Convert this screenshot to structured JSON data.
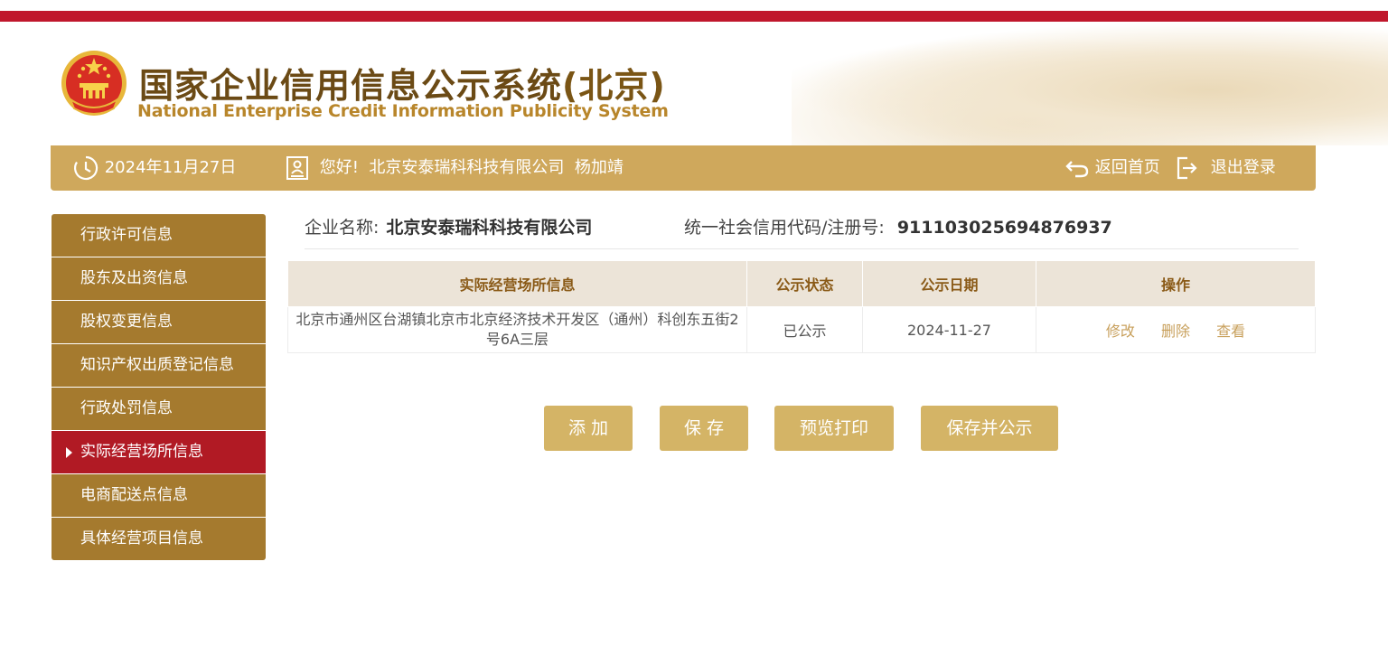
{
  "header": {
    "title_cn": "国家企业信用信息公示系统",
    "title_region": "(北京)",
    "title_en": "National Enterprise Credit Information Publicity System"
  },
  "infobar": {
    "date": "2024年11月27日",
    "greeting": "您好!  北京安泰瑞科科技有限公司  杨加靖",
    "home_label": "返回首页",
    "logout_label": "退出登录"
  },
  "sidebar": {
    "items": [
      {
        "label": "行政许可信息"
      },
      {
        "label": "股东及出资信息"
      },
      {
        "label": "股权变更信息"
      },
      {
        "label": "知识产权出质登记信息"
      },
      {
        "label": "行政处罚信息"
      },
      {
        "label": "实际经营场所信息",
        "active": true
      },
      {
        "label": "电商配送点信息"
      },
      {
        "label": "具体经营项目信息"
      }
    ]
  },
  "company": {
    "name_label": "企业名称:",
    "name_value": "北京安泰瑞科科技有限公司",
    "code_label": "统一社会信用代码/注册号:",
    "code_value": "911103025694876937"
  },
  "table": {
    "headers": [
      "实际经营场所信息",
      "公示状态",
      "公示日期",
      "操作"
    ],
    "rows": [
      {
        "address": "北京市通州区台湖镇北京市北京经济技术开发区（通州）科创东五街2号6A三层",
        "status": "已公示",
        "date": "2024-11-27",
        "actions": [
          "修改",
          "删除",
          "查看"
        ]
      }
    ]
  },
  "buttons": {
    "add": "添 加",
    "save": "保 存",
    "preview": "预览打印",
    "save_publish": "保存并公示"
  },
  "colors": {
    "top_red": "#c0172c",
    "gold_bar": "#cfa85c",
    "sidebar_brown": "#a57a2e",
    "sidebar_active": "#b11a24",
    "button_gold": "#d4b466"
  }
}
